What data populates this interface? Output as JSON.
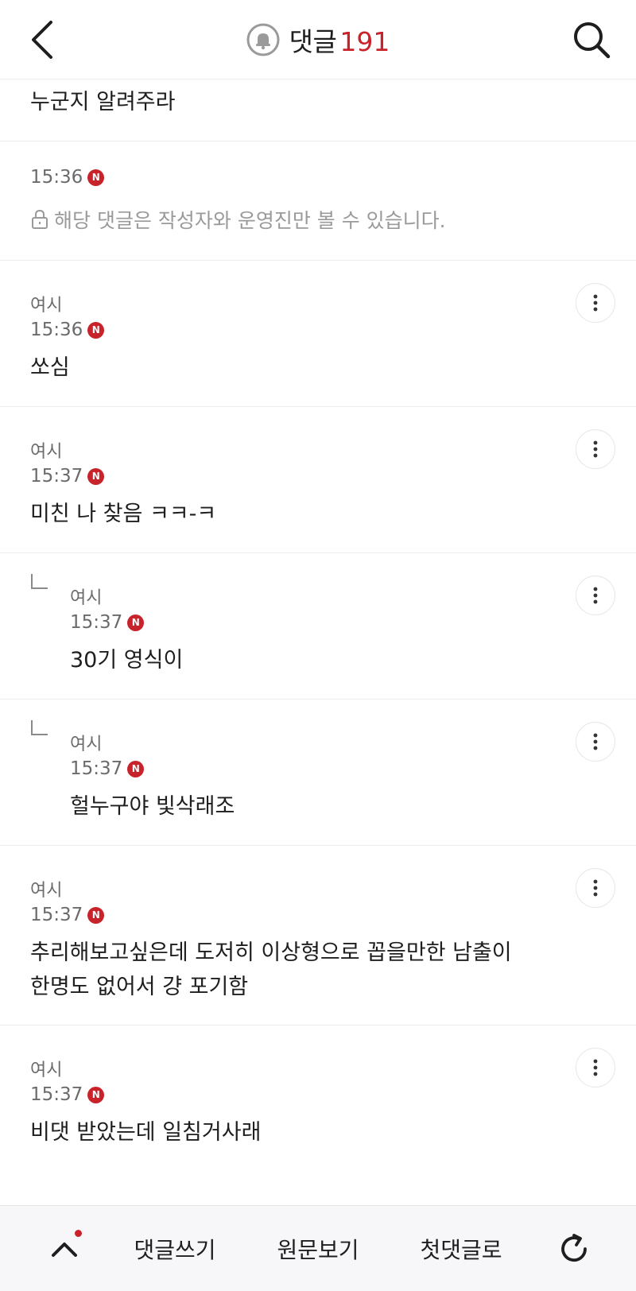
{
  "header": {
    "title": "댓글",
    "count": "191"
  },
  "comments": [
    {
      "body": "누군지 알려주라"
    },
    {
      "time": "15:36",
      "badge": "N",
      "locked_text": "해당 댓글은 작성자와 운영진만 볼 수 있습니다."
    },
    {
      "author": "여시",
      "time": "15:36",
      "badge": "N",
      "body": "쏘심"
    },
    {
      "author": "여시",
      "time": "15:37",
      "badge": "N",
      "body": "미친 나 찾음 ㅋㅋ-ㅋ"
    },
    {
      "author": "여시",
      "time": "15:37",
      "badge": "N",
      "body": "30기 영식이",
      "reply": true
    },
    {
      "author": "여시",
      "time": "15:37",
      "badge": "N",
      "body": "헐누구야 빛삭래조",
      "reply": true
    },
    {
      "author": "여시",
      "time": "15:37",
      "badge": "N",
      "body_line1": "추리해보고싶은데 도저히 이상형으로 꼽을만한 남출이",
      "body_line2": "한명도 없어서 걍 포기함"
    },
    {
      "author": "여시",
      "time": "15:37",
      "badge": "N",
      "body": "비댓 받았는데 일침거사래"
    }
  ],
  "bottom_bar": {
    "write_label": "댓글쓰기",
    "original_label": "원문보기",
    "first_label": "첫댓글로"
  },
  "colors": {
    "accent": "#c8222a",
    "muted_text": "#6b6b6b",
    "locked_text": "#9a9a9a"
  },
  "icons": [
    "back-arrow-icon",
    "bell-icon",
    "search-icon",
    "lock-icon",
    "more-vertical-icon",
    "reply-arrow-icon",
    "chevron-up-icon",
    "refresh-icon"
  ]
}
